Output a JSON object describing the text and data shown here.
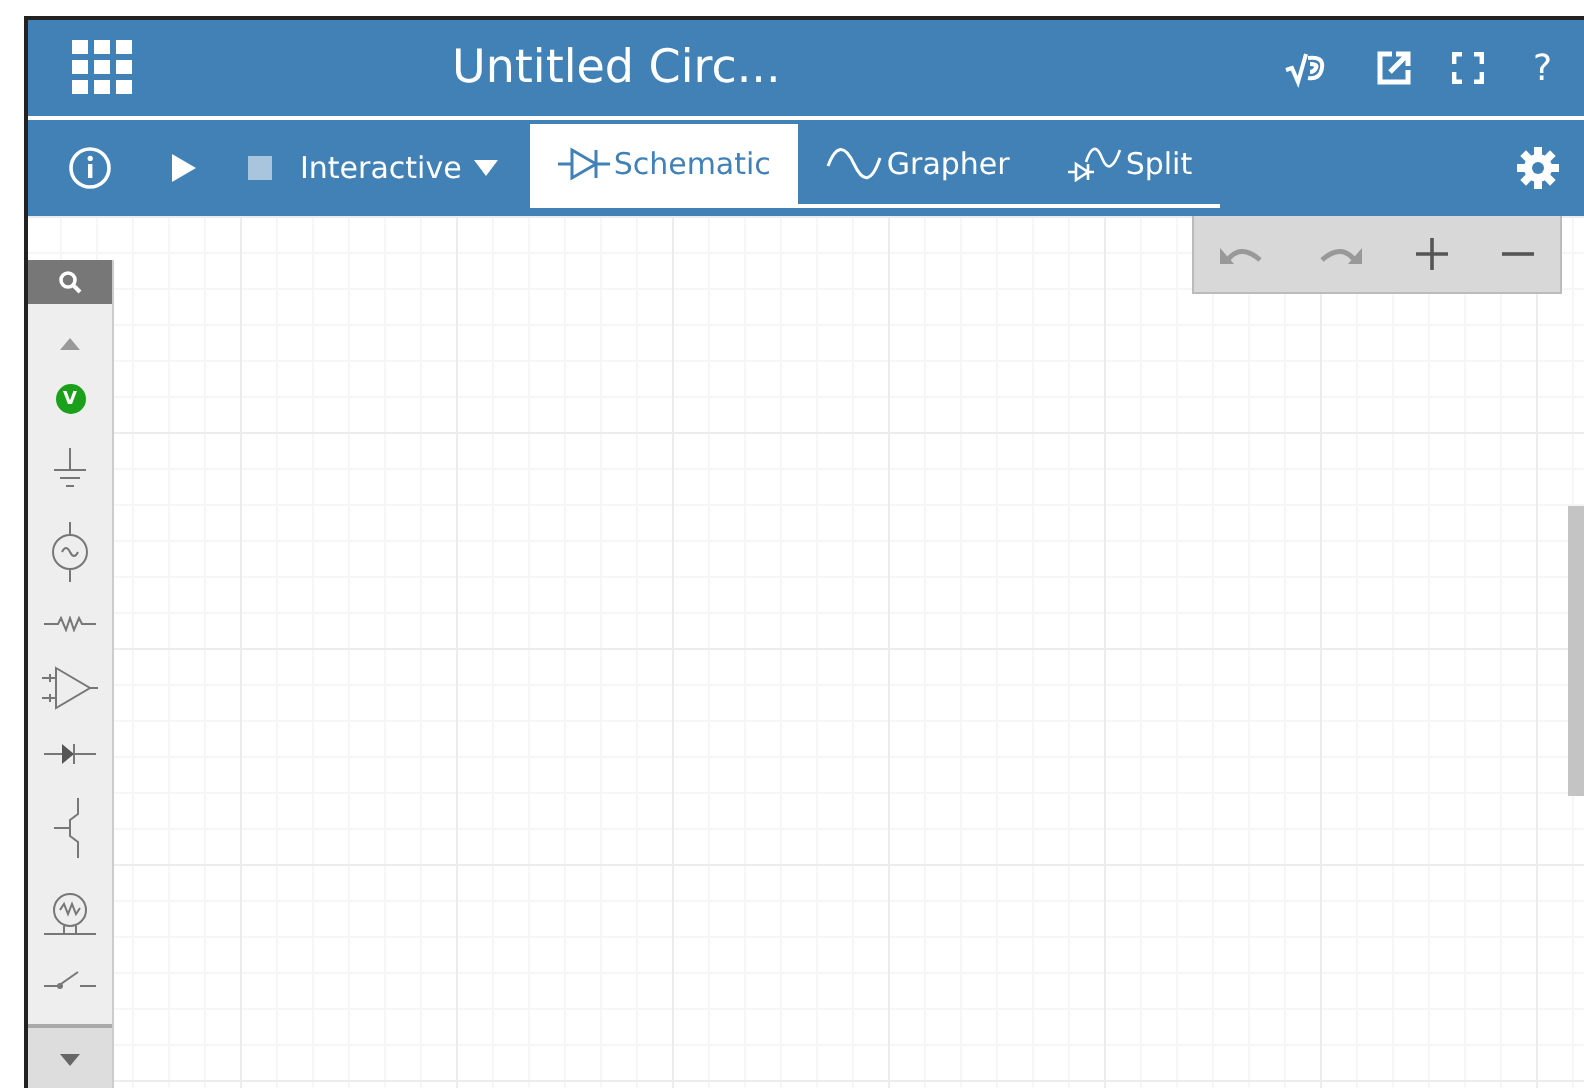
{
  "header": {
    "title": "Untitled Circ...",
    "help": "?"
  },
  "toolbar": {
    "mode": "Interactive",
    "tabs": [
      {
        "kind": "schematic",
        "label": "Schematic",
        "selected": true
      },
      {
        "kind": "grapher",
        "label": "Grapher",
        "selected": false
      },
      {
        "kind": "split",
        "label": "Split",
        "selected": false
      }
    ]
  },
  "palette": {
    "probe_label": "V"
  }
}
